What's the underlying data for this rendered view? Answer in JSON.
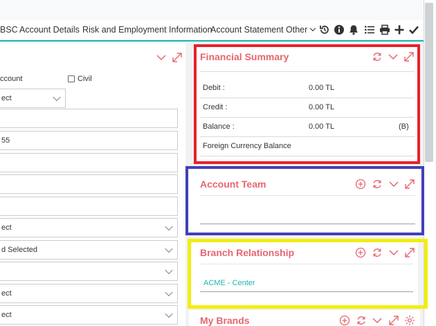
{
  "colors": {
    "accent": "#19b5ad",
    "panel_title": "#e6666f",
    "highlight_red": "#e8202a",
    "highlight_blue": "#4040b8",
    "highlight_yellow": "#f2ee0e",
    "link": "#19b5ad"
  },
  "tabs": [
    {
      "label": "BSC"
    },
    {
      "label": "Account Details"
    },
    {
      "label": "Risk and Employment Information"
    },
    {
      "label": "Account Statement"
    },
    {
      "label": "Other"
    }
  ],
  "toolbar_icons": [
    "history-icon",
    "info-icon",
    "bell-icon",
    "list-icon",
    "print-icon",
    "plus-icon",
    "check-icon"
  ],
  "left_form": {
    "account_type_option": "ccount",
    "civil_option": "Civil",
    "select_1": "ect",
    "field_value": "55",
    "select_2": "ect",
    "select_3": "d Selected",
    "select_4": "ect",
    "select_5": "ect"
  },
  "financial_summary": {
    "title": "Financial Summary",
    "rows": [
      {
        "label": "Debit :",
        "value": "0.00 TL",
        "suffix": ""
      },
      {
        "label": "Credit :",
        "value": "0.00 TL",
        "suffix": ""
      },
      {
        "label": "Balance :",
        "value": "0.00 TL",
        "suffix": "(B)"
      }
    ],
    "foreign_label": "Foreign Currency Balance"
  },
  "account_team": {
    "title": "Account Team"
  },
  "branch_relationship": {
    "title": "Branch Relationship",
    "branch_link": "ACME - Center"
  },
  "my_brands": {
    "title": "My Brands"
  }
}
